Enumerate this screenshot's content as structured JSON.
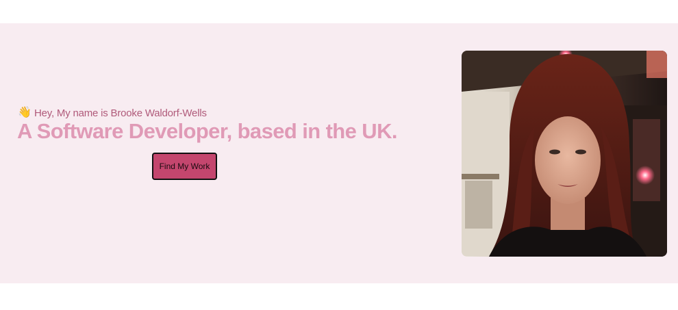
{
  "hero": {
    "intro_icon": "waving-hand-icon",
    "intro_emoji": "👋",
    "intro_text": "Hey, My name is Brooke Waldorf-Wells",
    "headline": "A Software Developer, based in the UK.",
    "cta_label": "Find My Work",
    "photo_icon": "profile-photo"
  },
  "colors": {
    "hero_background": "#f8ecf1",
    "intro_text": "#b05a7a",
    "headline": "#e09ab6",
    "button_fill": "#c4466e",
    "button_border": "#111111"
  }
}
